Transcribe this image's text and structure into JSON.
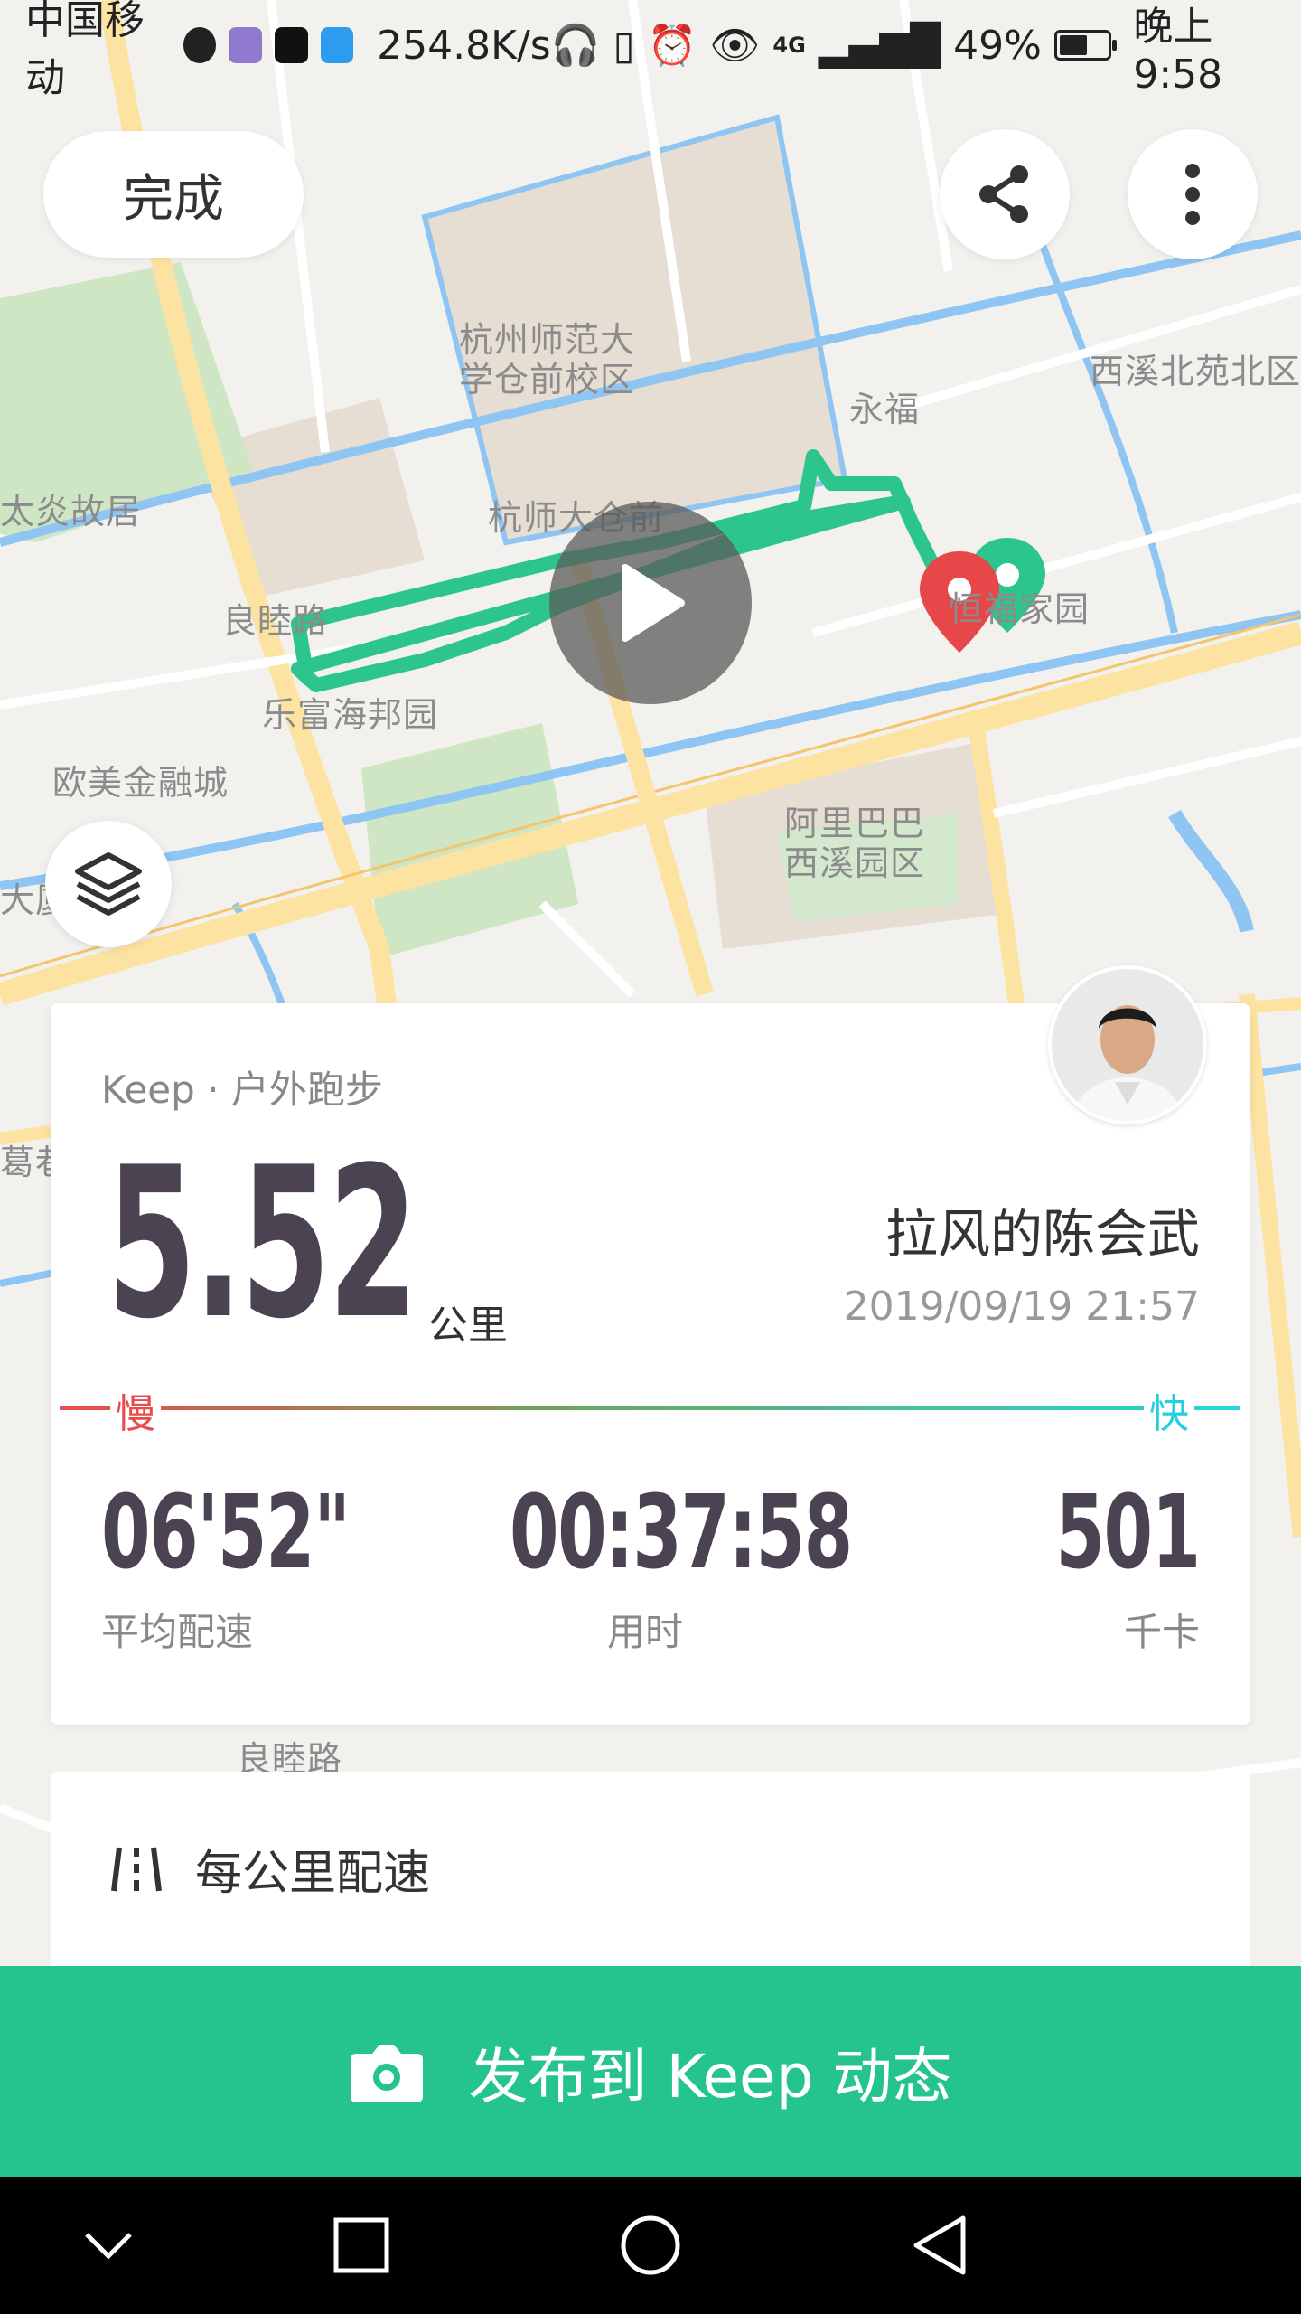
{
  "status_bar": {
    "carrier": "中国移动",
    "network_speed": "254.8K/s",
    "signal_label": "4G",
    "battery_percent": "49%",
    "battery_level": 0.49,
    "time": "晚上9:58"
  },
  "map": {
    "labels": [
      "杭州师范大\n学仓前校区",
      "永福",
      "西溪北苑北区",
      "太炎故居",
      "杭师大仓前",
      "良睦路",
      "乐富海邦园",
      "欧美金融城",
      "大厦",
      "阿里巴巴\n西溪园区",
      "恒福家园",
      "葛巷",
      "良睦路"
    ],
    "route_color": "#2cc68c"
  },
  "header": {
    "done_label": "完成",
    "share_icon": "share-icon",
    "more_icon": "more-vertical-icon"
  },
  "summary": {
    "source": "Keep · 户外跑步",
    "distance": "5.52",
    "distance_unit": "公里",
    "user_name": "拉风的陈会武",
    "datetime": "2019/09/19 21:57",
    "pace_slow_label": "慢",
    "pace_fast_label": "快",
    "stats": [
      {
        "value": "06'52\"",
        "label": "平均配速"
      },
      {
        "value": "00:37:58",
        "label": "用时"
      },
      {
        "value": "501",
        "label": "千卡"
      }
    ]
  },
  "splits": {
    "title": "每公里配速"
  },
  "publish": {
    "label": "发布到 Keep 动态"
  },
  "colors": {
    "accent": "#26c48d",
    "stat_text": "#4b4352",
    "slow": "#e94b4b",
    "fast": "#25cfe0"
  }
}
